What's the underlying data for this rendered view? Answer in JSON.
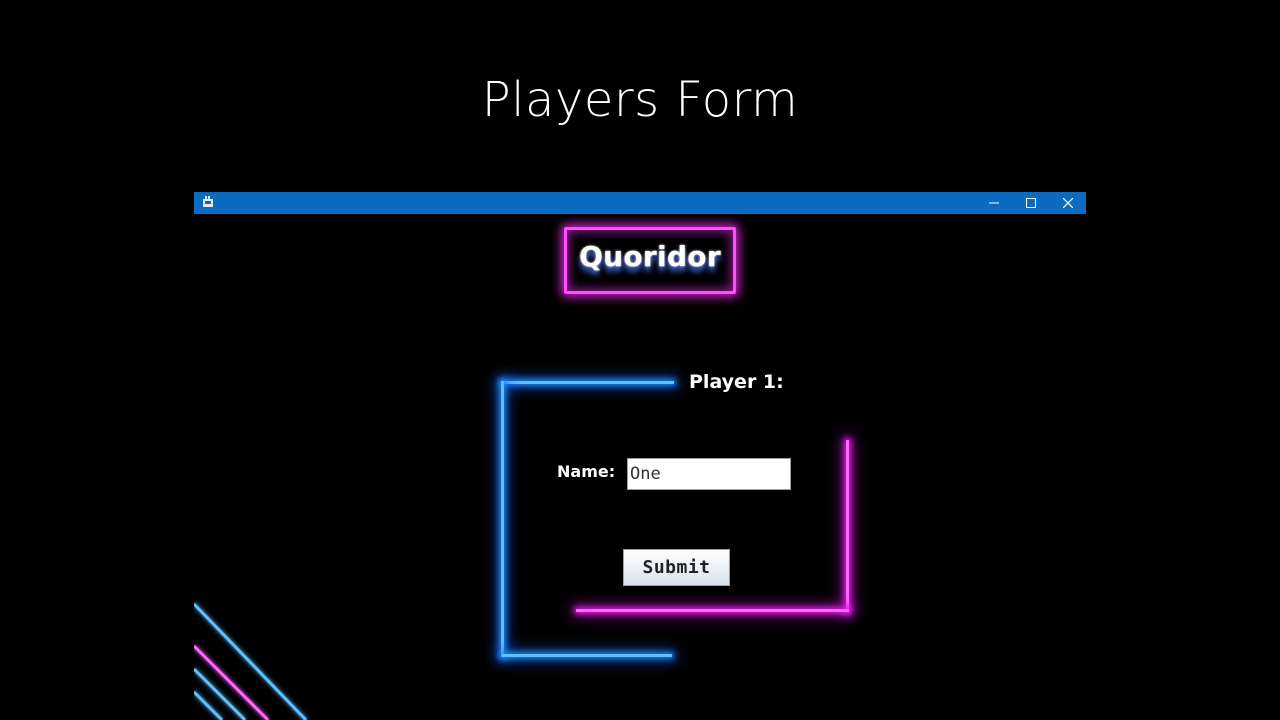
{
  "slide": {
    "title": "Players Form"
  },
  "window": {
    "app_icon": "java-app-icon",
    "controls": {
      "minimize": "minimize-icon",
      "maximize": "maximize-icon",
      "close": "close-icon"
    }
  },
  "app": {
    "logo_text": "Quoridor",
    "player_label": "Player 1:",
    "name_label": "Name:",
    "name_value": "One",
    "submit_label": "Submit"
  },
  "colors": {
    "titlebar": "#0b6bc0",
    "background": "#000000",
    "neon_blue": "#5fc0ff",
    "neon_pink": "#ff66ff"
  }
}
